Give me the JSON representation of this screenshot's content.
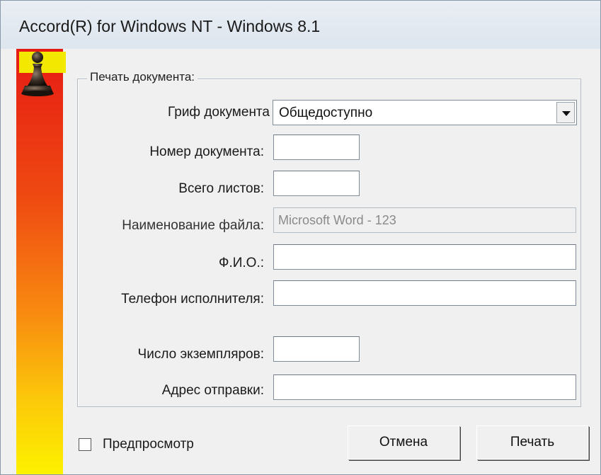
{
  "window": {
    "title": "Accord(R) for Windows NT - Windows 8.1"
  },
  "sidebar": {
    "icon": "chess-pawn-icon",
    "gradient_colors": [
      "#e61b14",
      "#f88a10",
      "#fdf200"
    ]
  },
  "form": {
    "group_title": "Печать документа:",
    "classification_label": "Гриф документа",
    "classification_value": "Общедоступно",
    "doc_number_label": "Номер документа:",
    "doc_number_value": "",
    "total_sheets_label": "Всего листов:",
    "total_sheets_value": "",
    "file_name_label": "Наименование файла:",
    "file_name_value": "Microsoft Word - 123",
    "full_name_label": "Ф.И.О.:",
    "full_name_value": "",
    "executor_phone_label": "Телефон исполнителя:",
    "executor_phone_value": "",
    "copies_label": "Число экземпляров:",
    "copies_value": "",
    "send_address_label": "Адрес отправки:",
    "send_address_value": ""
  },
  "footer": {
    "preview_label": "Предпросмотр",
    "preview_checked": false,
    "cancel_label": "Отмена",
    "print_label": "Печать"
  }
}
